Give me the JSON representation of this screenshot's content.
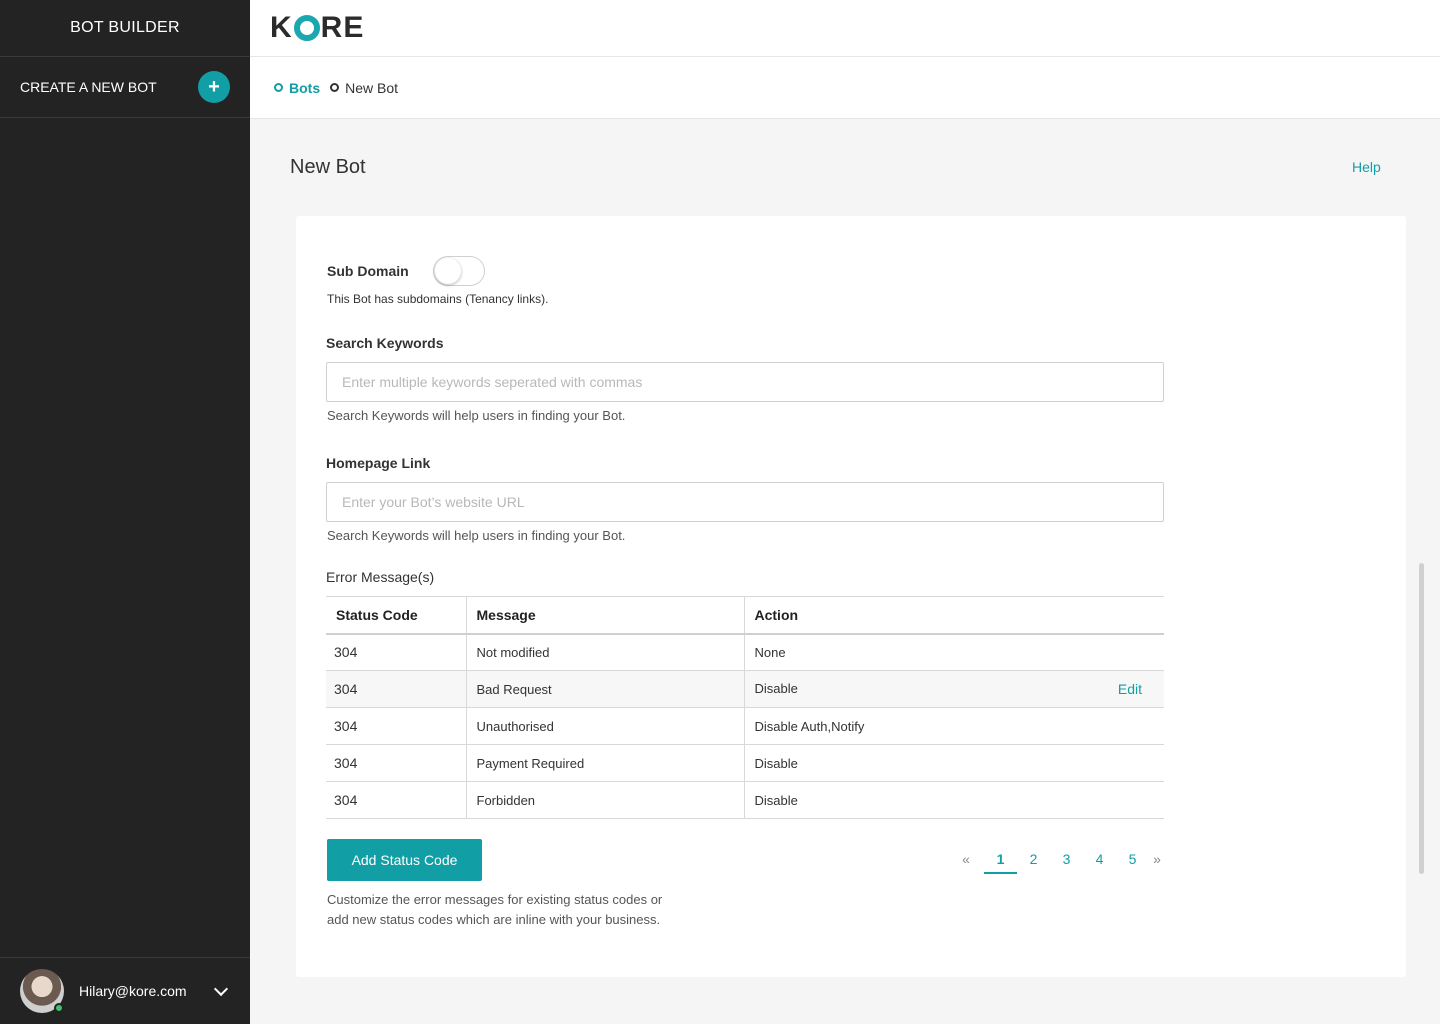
{
  "sidebar": {
    "title": "BOT BUILDER",
    "create_label": "CREATE A NEW BOT",
    "create_icon": "+",
    "user_email": "Hilary@kore.com"
  },
  "header": {
    "logo_text_1": "K",
    "logo_text_2": "RE",
    "brand_color": "#129ea5"
  },
  "breadcrumb": {
    "items": [
      {
        "label": "Bots"
      },
      {
        "label": "New Bot"
      }
    ]
  },
  "main": {
    "title": "New Bot",
    "help_label": "Help",
    "sub_domain": {
      "label": "Sub Domain",
      "hint": "This Bot has subdomains (Tenancy links).",
      "enabled": false
    },
    "search_keywords": {
      "label": "Search Keywords",
      "placeholder": "Enter multiple keywords seperated with commas",
      "hint": "Search Keywords will help users in finding your Bot."
    },
    "homepage": {
      "label": "Homepage Link",
      "placeholder": "Enter your Bot’s website URL",
      "hint": "Search Keywords will help users in finding your Bot."
    },
    "errors": {
      "label": "Error Message(s)",
      "columns": [
        "Status Code",
        "Message",
        "Action"
      ],
      "rows": [
        {
          "code": "304",
          "message": "Not modified",
          "action": "None"
        },
        {
          "code": "304",
          "message": "Bad Request",
          "action": "Disable",
          "edit": "Edit"
        },
        {
          "code": "304",
          "message": "Unauthorised",
          "action": "Disable Auth,Notify"
        },
        {
          "code": "304",
          "message": "Payment Required",
          "action": "Disable"
        },
        {
          "code": "304",
          "message": "Forbidden",
          "action": "Disable"
        }
      ],
      "add_button": "Add Status Code",
      "add_hint": "Customize the error messages for existing status codes or add new status codes which are inline with your business.",
      "pagination": {
        "prev": "«",
        "next": "»",
        "pages": [
          "1",
          "2",
          "3",
          "4",
          "5"
        ],
        "current": "1"
      }
    }
  }
}
